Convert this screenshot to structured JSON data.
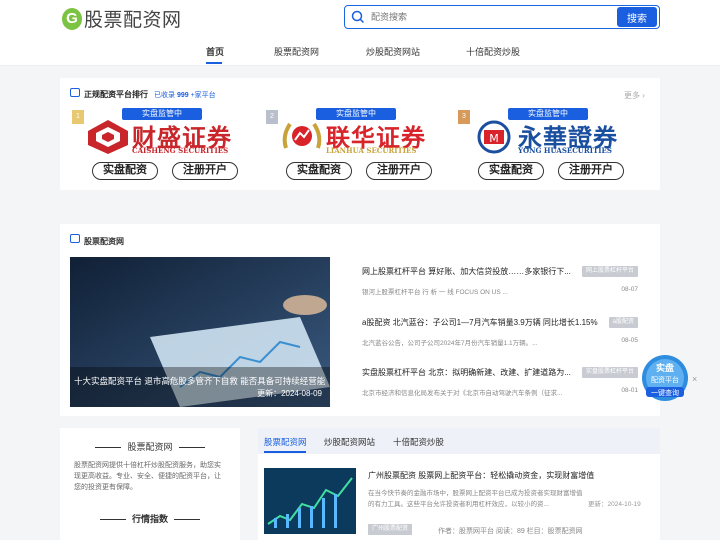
{
  "header": {
    "logo_letter": "G",
    "site_name": "股票配资网",
    "search_placeholder": "配资搜索",
    "search_button": "搜索"
  },
  "nav": {
    "items": [
      "首页",
      "股票配资网",
      "炒股配资网站",
      "十倍配资炒股"
    ],
    "active": "首页"
  },
  "platforms": {
    "title": "正规配资平台排行",
    "subtitle_prefix": "已收录",
    "subtitle_count": "999",
    "subtitle_suffix": "+家平台",
    "more": "更多",
    "brokers": [
      {
        "rank": "1",
        "badge": "实盘监管中",
        "name": "财盛证券",
        "en": "CAISHENG SECURITIES",
        "color": "#c8262b",
        "btn1": "实盘配资",
        "btn2": "注册开户"
      },
      {
        "rank": "2",
        "badge": "实盘监管中",
        "name": "联华证券",
        "en": "LIANHUA SECURITIES",
        "color": "#d8232a",
        "btn1": "实盘配资",
        "btn2": "注册开户"
      },
      {
        "rank": "3",
        "badge": "实盘监管中",
        "name": "永華證券",
        "en": "YONG HUASECURITIES",
        "color": "#1a4fa0",
        "btn1": "实盘配资",
        "btn2": "注册开户"
      }
    ]
  },
  "section2": {
    "title": "股票配资网",
    "feature": {
      "caption": "十大实盘配资平台 退市高危股多管齐下自救 能否具备可持续经营能",
      "date": "更新：2024-08-09"
    },
    "news": [
      {
        "title": "网上股票杠杆平台 算好账、加大信贷投放……多家银行下...",
        "tag": "网上股票杠杆平台",
        "snip": "银河上股票杠杆平台 行 析 一 线 FOCUS ON US ...",
        "date": "08-07"
      },
      {
        "title": "a股配资 北汽蓝谷：子公司1—7月汽车销量3.9万辆 同比增长1.15%",
        "tag": "a股配资",
        "snip": "北汽蓝谷公告，公司子公司2024年7月份汽车销量1.1万辆。...",
        "date": "08-05"
      },
      {
        "title": "实盘股票杠杆平台 北京：拟明确新建、改建、扩建道路为...",
        "tag": "实盘股票杠杆平台",
        "snip": "北京市经济和信息化局发布关于对《北京市自动驾驶汽车条例（征求...",
        "date": "08-01"
      }
    ]
  },
  "float_ad": {
    "line1": "实盘",
    "line2": "配资平台",
    "line3": "一键查询",
    "close": "×"
  },
  "sidebar": {
    "title": "股票配资网",
    "desc": "股票配资网提供十倍杠杆炒股配资服务，助您实现更高收益。专业、安全、便捷的配资平台，让您的投资更有保障。",
    "title2": "行情指数"
  },
  "main_tabs": {
    "tabs": [
      "股票配资网",
      "炒股配资网站",
      "十倍配资炒股"
    ],
    "active": "股票配资网"
  },
  "article": {
    "title": "广州股票配资 股票网上配资平台：轻松撬动资金，实现财富增值",
    "snip": "在当今快节奏的金融市场中，股票网上配资平台已成为投资者实现财富增值的有力工具。这些平台允许投资者利用杠杆效应，以较小的资...",
    "date": "更新：2024-10-19",
    "tag": "广州股票配资",
    "meta": "作者：股票网平台    阅读：89    栏目：股票配资网"
  }
}
